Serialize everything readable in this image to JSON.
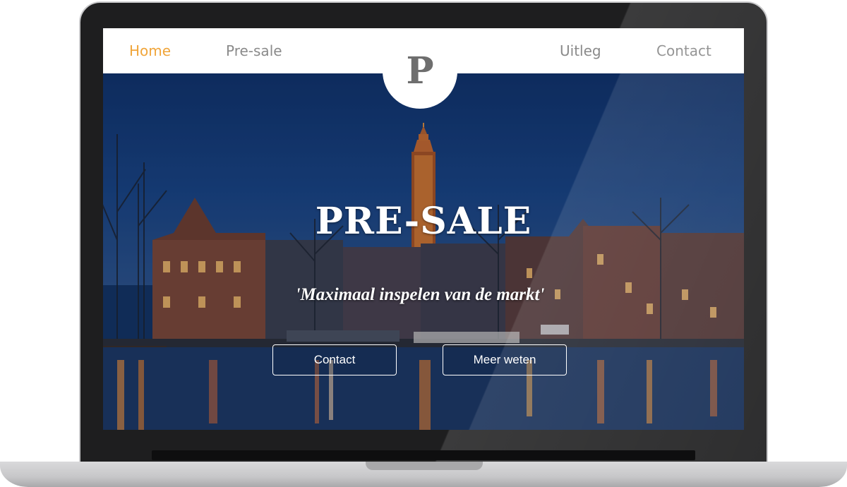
{
  "nav": {
    "home": "Home",
    "presale": "Pre-sale",
    "uitleg": "Uitleg",
    "contact": "Contact",
    "active": "Home",
    "active_color": "#f0a53a",
    "link_color": "#8a8a8a"
  },
  "logo": {
    "letter": "P"
  },
  "hero": {
    "title": "PRE-SALE",
    "subtitle": "'Maximaal inspelen van de markt'",
    "contact_button": "Contact",
    "more_button": "Meer weten",
    "background": "night-city-canal-photo"
  },
  "colors": {
    "accent": "#f0a53a",
    "sky": "#0f2f66",
    "laptop_frame": "#1e1e1f"
  }
}
